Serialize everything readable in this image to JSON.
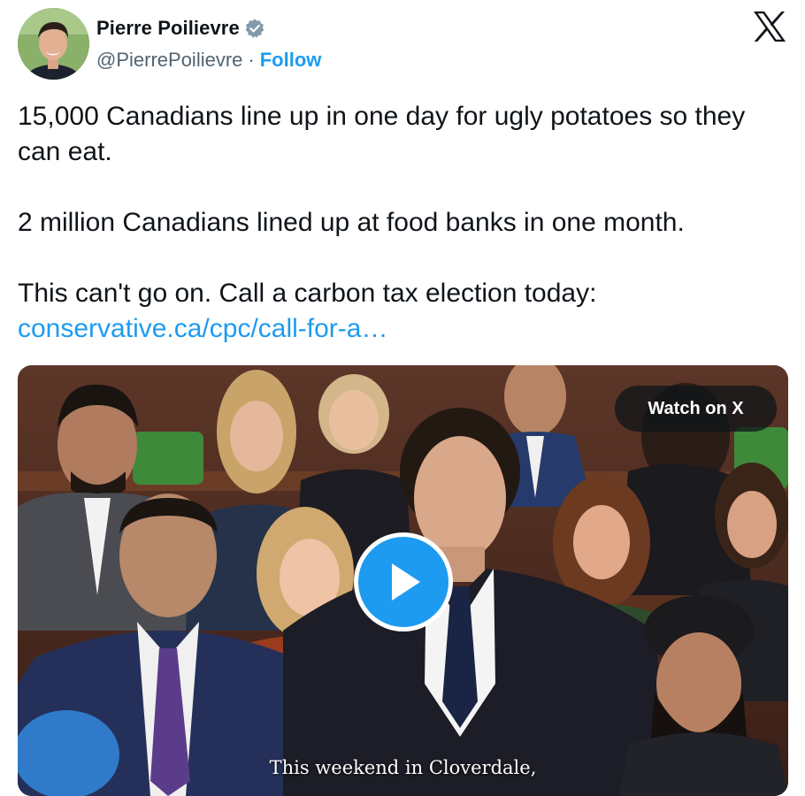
{
  "author": {
    "display_name": "Pierre Poilievre",
    "handle": "@PierrePoilievre",
    "separator": "·",
    "follow_label": "Follow",
    "verified": true,
    "avatar_icon": "avatar-photo"
  },
  "header": {
    "platform_logo": "x-logo-icon"
  },
  "tweet": {
    "paragraph_1": "15,000 Canadians line up in one day for ugly potatoes so they can eat.",
    "paragraph_2": "2 million Canadians lined up at food banks in one month.",
    "paragraph_3": "This can't go on. Call a carbon tax election today:",
    "link_text": "conservative.ca/cpc/call-for-a…"
  },
  "media": {
    "type": "video",
    "watch_label": "Watch on X",
    "caption": "This weekend in Cloverdale,",
    "play_icon": "play-icon"
  },
  "colors": {
    "accent": "#1d9bf0",
    "text": "#0f1419",
    "secondary_text": "#536471"
  }
}
